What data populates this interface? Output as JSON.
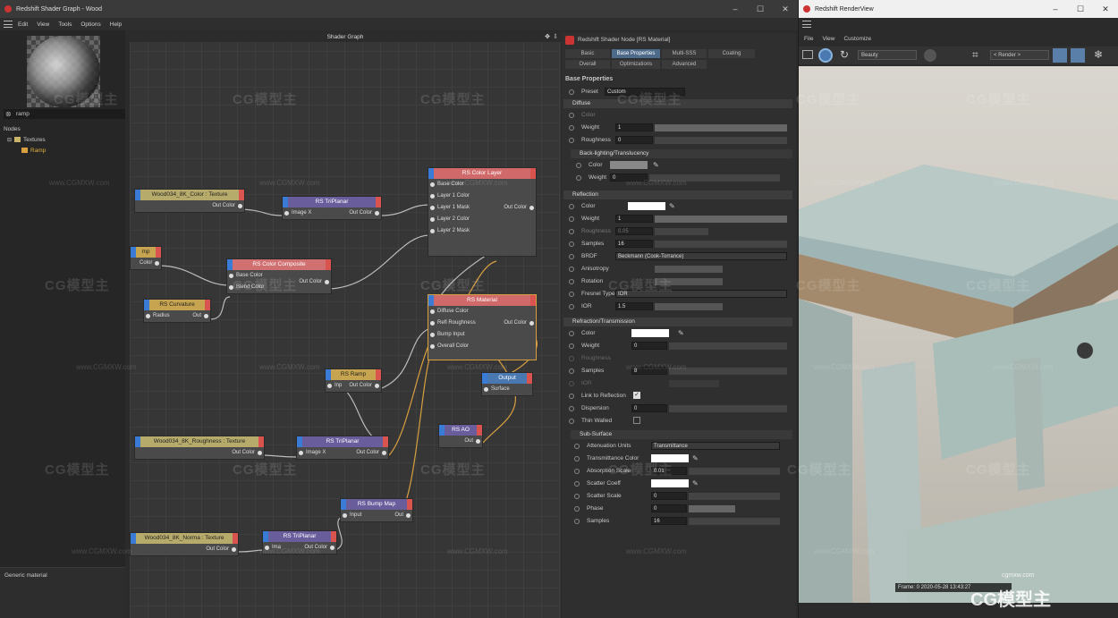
{
  "left_window": {
    "title": "Redshift Shader Graph - Wood",
    "menu": [
      "Edit",
      "View",
      "Tools",
      "Options",
      "Help"
    ],
    "search_value": "ramp",
    "tree_header": "Nodes",
    "tree_items": [
      "Textures",
      "Ramp"
    ],
    "info_text": "Generic material"
  },
  "graph": {
    "title": "Shader Graph",
    "nodes": {
      "color_texture": {
        "title": "Wood034_8K_Color : Texture",
        "out": "Out Color"
      },
      "triplanar1": {
        "title": "RS TriPlanar",
        "in": "Image X",
        "out": "Out Color"
      },
      "color_layer": {
        "title": "RS Color Layer",
        "ports": [
          "Base Color",
          "Layer 1 Color",
          "Layer 1 Mask",
          "Layer 2 Color",
          "Layer 2 Mask"
        ],
        "out": "Out Color"
      },
      "ramp_left": {
        "title": "mp",
        "out": "Color"
      },
      "color_composite": {
        "title": "RS Color Composite",
        "ports": [
          "Base Color",
          "Blend Color"
        ],
        "out": "Out Color"
      },
      "curvature": {
        "title": "RS Curvature",
        "in": "Radius",
        "out": "Out"
      },
      "material": {
        "title": "RS Material",
        "ports": [
          "Diffuse Color",
          "Refl Roughness",
          "Bump Input",
          "Overall Color"
        ],
        "out": "Out Color"
      },
      "ramp": {
        "title": "RS Ramp",
        "in": "Inp",
        "out": "Out Color"
      },
      "output": {
        "title": "Output",
        "in": "Surface"
      },
      "ao": {
        "title": "RS AO",
        "out": "Out"
      },
      "rough_texture": {
        "title": "Wood034_8K_Roughness : Texture",
        "out": "Out Color"
      },
      "triplanar2": {
        "title": "RS TriPlanar",
        "in": "Image X",
        "out": "Out Color"
      },
      "bumpmap": {
        "title": "RS Bump Map",
        "in": "Input",
        "out": "Out"
      },
      "normal_texture": {
        "title": "Wood034_8K_Norma : Texture",
        "out": "Out Color"
      },
      "triplanar3": {
        "title": "RS TriPlanar",
        "in": "Ima",
        "out": "Out Color"
      }
    }
  },
  "attributes": {
    "node_title": "Redshift Shader Node [RS Material]",
    "tabs_row1": [
      "Basic",
      "Base Properties",
      "Multi-SSS",
      "Coating"
    ],
    "tabs_row2": [
      "Overall",
      "Optimizations",
      "Advanced"
    ],
    "base_properties": "Base Properties",
    "preset_label": "Preset",
    "preset_value": "Custom",
    "diffuse": {
      "header": "Diffuse",
      "color": "Color",
      "weight": "Weight",
      "weight_val": "1",
      "roughness": "Roughness",
      "roughness_val": "0"
    },
    "backlighting": {
      "header": "Back-lighting/Translucency",
      "color": "Color",
      "weight": "Weight",
      "weight_val": "0"
    },
    "reflection": {
      "header": "Reflection",
      "color": "Color",
      "weight": "Weight",
      "weight_val": "1",
      "roughness": "Roughness",
      "roughness_val": "0.05",
      "samples": "Samples",
      "samples_val": "16",
      "brdf": "BRDF",
      "brdf_val": "Beckmann (Cook-Torrance)",
      "anisotropy": "Anisotropy",
      "rotation": "Rotation",
      "fresnel": "Fresnel Type",
      "fresnel_val": "IOR",
      "ior": "IOR",
      "ior_val": "1.5"
    },
    "refraction": {
      "header": "Refraction/Transmission",
      "color": "Color",
      "weight": "Weight",
      "weight_val": "0",
      "roughness": "Roughness",
      "samples": "Samples",
      "samples_val": "8",
      "ior": "IOR",
      "link": "Link to Reflection",
      "dispersion": "Dispersion",
      "dispersion_val": "0",
      "thin": "Thin Walled"
    },
    "subsurface": {
      "header": "Sub-Surface",
      "atten": "Attenuation Units",
      "atten_val": "Transmittance",
      "trans_color": "Transmittance Color",
      "absorption": "Absorption Scale",
      "absorption_val": "0.01",
      "scatter_coeff": "Scatter Coeff",
      "scatter_scale": "Scatter Scale",
      "scatter_scale_val": "0",
      "phase": "Phase",
      "phase_val": "0",
      "samples": "Samples",
      "samples_val": "16"
    }
  },
  "render_window": {
    "title": "Redshift RenderView",
    "menu": [
      "File",
      "View",
      "Customize"
    ],
    "aov_value": "Beauty",
    "render_value": "< Render >",
    "frame_info": "Frame: 0   2020-05-28 13:43:27"
  },
  "watermarks": {
    "logo": "CG模型主",
    "url": "www.CGMXW.com",
    "url_small": "cgmxw.com"
  }
}
